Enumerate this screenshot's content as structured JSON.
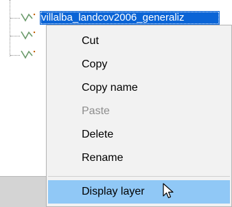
{
  "tree": {
    "selected_layer_label": "villalba_landcov2006_generaliz",
    "top_cut_text": "- - - -  - - - - - -   - -  -  -  - -   - - -"
  },
  "context_menu": {
    "items": [
      {
        "label": "Cut",
        "enabled": true
      },
      {
        "label": "Copy",
        "enabled": true
      },
      {
        "label": "Copy name",
        "enabled": true
      },
      {
        "label": "Paste",
        "enabled": false
      },
      {
        "label": "Delete",
        "enabled": true
      },
      {
        "label": "Rename",
        "enabled": true
      },
      {
        "label": "Display layer",
        "enabled": true,
        "hovered": true
      }
    ]
  },
  "colors": {
    "selection": "#0a64d6",
    "hover": "#90c8f6",
    "menu_bg": "#f2f2f2",
    "disabled_text": "#8d8d8d"
  },
  "icons": {
    "layer": "line-layer-icon",
    "cursor": "arrow-cursor-icon"
  }
}
